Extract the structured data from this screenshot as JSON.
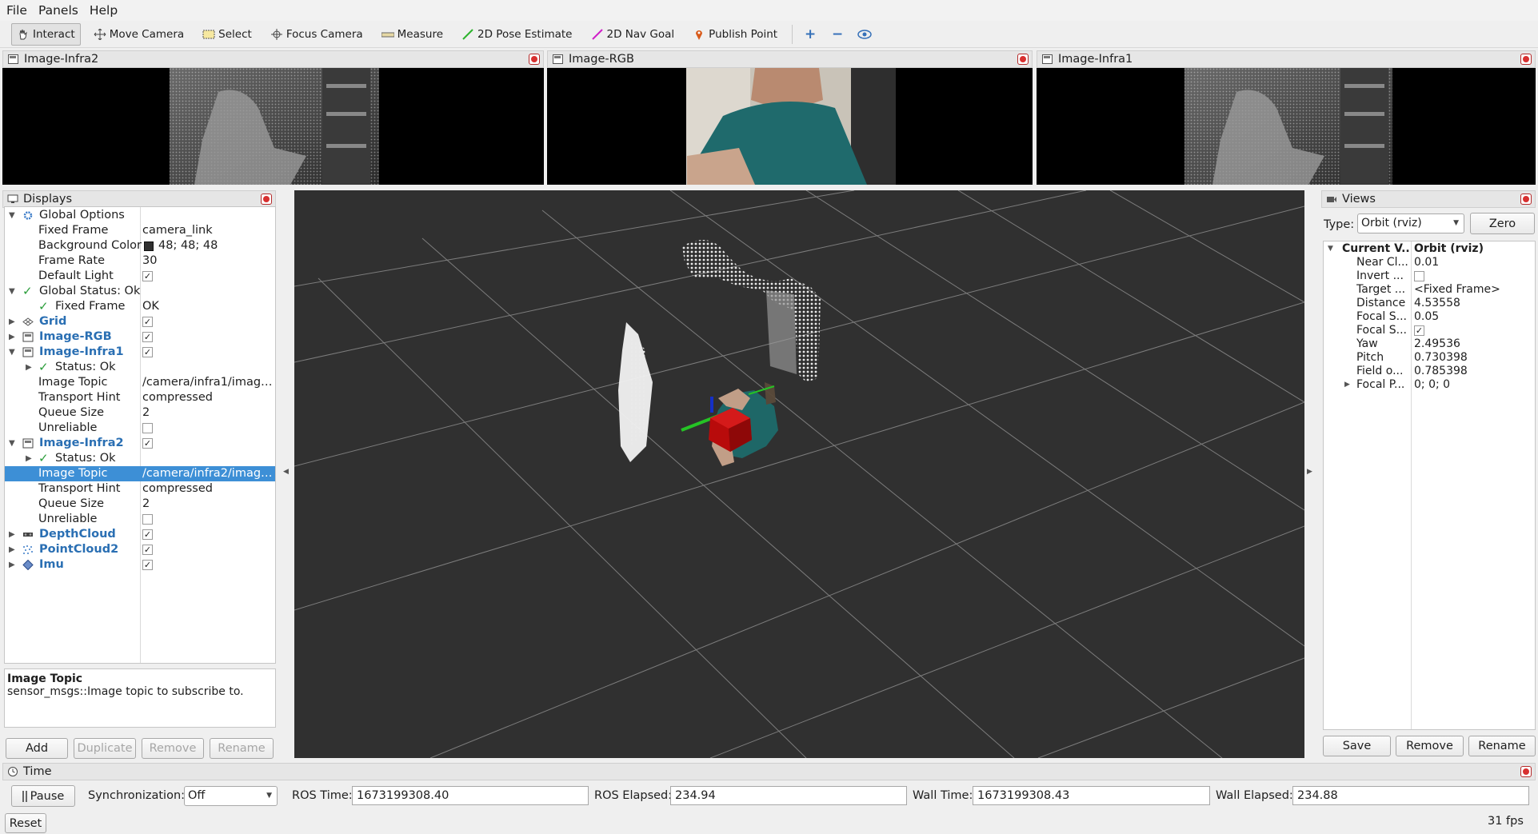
{
  "menus": [
    "File",
    "Panels",
    "Help"
  ],
  "toolbar": {
    "interact": "Interact",
    "move_camera": "Move Camera",
    "select": "Select",
    "focus_camera": "Focus Camera",
    "measure": "Measure",
    "pose_estimate": "2D Pose Estimate",
    "nav_goal": "2D Nav Goal",
    "publish_point": "Publish Point",
    "colors": {
      "pose": "#2db42d",
      "nav": "#d020c8",
      "publish": "#d85a1a"
    }
  },
  "image_panels": [
    {
      "title": "Image-Infra2"
    },
    {
      "title": "Image-RGB"
    },
    {
      "title": "Image-Infra1"
    }
  ],
  "displays": {
    "title": "Displays",
    "global_options": "Global Options",
    "fixed_frame_label": "Fixed Frame",
    "fixed_frame_value": "camera_link",
    "bg_color_label": "Background Color",
    "bg_color_value": "48; 48; 48",
    "bg_color_hex": "#303030",
    "frame_rate_label": "Frame Rate",
    "frame_rate_value": "30",
    "default_light_label": "Default Light",
    "global_status": "Global Status: Ok",
    "fixed_frame_status_label": "Fixed Frame",
    "fixed_frame_status_value": "OK",
    "grid": "Grid",
    "image_rgb": "Image-RGB",
    "image_infra1": "Image-Infra1",
    "status_ok_1": "Status: Ok",
    "image_topic_label_1": "Image Topic",
    "image_topic_value_1": "/camera/infra1/image...",
    "transport_hint_label_1": "Transport Hint",
    "transport_hint_value_1": "compressed",
    "queue_size_label_1": "Queue Size",
    "queue_size_value_1": "2",
    "unreliable_label_1": "Unreliable",
    "image_infra2": "Image-Infra2",
    "status_ok_2": "Status: Ok",
    "image_topic_label_2": "Image Topic",
    "image_topic_value_2": "/camera/infra2/image...",
    "transport_hint_label_2": "Transport Hint",
    "transport_hint_value_2": "compressed",
    "queue_size_label_2": "Queue Size",
    "queue_size_value_2": "2",
    "unreliable_label_2": "Unreliable",
    "depthcloud": "DepthCloud",
    "pointcloud2": "PointCloud2",
    "imu": "Imu",
    "desc_title": "Image Topic",
    "desc_text": "sensor_msgs::Image topic to subscribe to.",
    "add": "Add",
    "duplicate": "Duplicate",
    "remove": "Remove",
    "rename": "Rename"
  },
  "views": {
    "title": "Views",
    "type_label": "Type:",
    "type_value": "Orbit (rviz)",
    "zero": "Zero",
    "current_view_label": "Current V...",
    "current_view_value": "Orbit (rviz)",
    "rows": [
      {
        "label": "Near Cl...",
        "value": "0.01"
      },
      {
        "label": "Invert ...",
        "value": ""
      },
      {
        "label": "Target ...",
        "value": "<Fixed Frame>"
      },
      {
        "label": "Distance",
        "value": "4.53558"
      },
      {
        "label": "Focal S...",
        "value": "0.05"
      },
      {
        "label": "Focal S...",
        "value": ""
      },
      {
        "label": "Yaw",
        "value": "2.49536"
      },
      {
        "label": "Pitch",
        "value": "0.730398"
      },
      {
        "label": "Field o...",
        "value": "0.785398"
      },
      {
        "label": "Focal P...",
        "value": "0; 0; 0"
      }
    ],
    "save": "Save",
    "remove": "Remove",
    "rename": "Rename"
  },
  "time": {
    "title": "Time",
    "pause": "Pause",
    "sync_label": "Synchronization:",
    "sync_value": "Off",
    "ros_time_label": "ROS Time:",
    "ros_time": "1673199308.40",
    "ros_elapsed_label": "ROS Elapsed:",
    "ros_elapsed": "234.94",
    "wall_time_label": "Wall Time:",
    "wall_time": "1673199308.43",
    "wall_elapsed_label": "Wall Elapsed:",
    "wall_elapsed": "234.88",
    "reset": "Reset",
    "fps": "31 fps"
  }
}
